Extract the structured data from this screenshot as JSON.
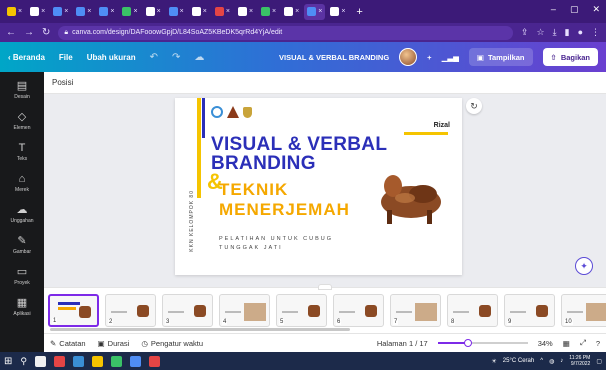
{
  "browser": {
    "tabs": [
      {
        "label": "",
        "color": "#f5c400"
      },
      {
        "label": "",
        "color": "#ffffff"
      },
      {
        "label": "",
        "color": "#4f8df5"
      },
      {
        "label": "",
        "color": "#4f8df5"
      },
      {
        "label": "",
        "color": "#4f8df5"
      },
      {
        "label": "",
        "color": "#3ac267"
      },
      {
        "label": "",
        "color": "#ffffff"
      },
      {
        "label": "",
        "color": "#4f8df5"
      },
      {
        "label": "",
        "color": "#ffffff"
      },
      {
        "label": "",
        "color": "#e54545"
      },
      {
        "label": "",
        "color": "#ffffff"
      },
      {
        "label": "",
        "color": "#3ac267"
      },
      {
        "label": "",
        "color": "#ffffff"
      },
      {
        "label": "",
        "color": "#4f8df5"
      },
      {
        "label": "",
        "color": "#ffffff"
      }
    ],
    "url": "canva.com/design/DAFooowGpjD/L84SoAZ5KBeDK5qrRd4YjA/edit",
    "window_controls": [
      "–",
      "▢",
      "✕"
    ]
  },
  "toolbar": {
    "home_label": "Beranda",
    "file_label": "File",
    "resize_label": "Ubah ukuran",
    "design_title": "VISUAL & VERBAL BRANDING",
    "present_label": "Tampilkan",
    "share_label": "Bagikan"
  },
  "rail": {
    "items": [
      {
        "label": "Desain",
        "icon": "▤"
      },
      {
        "label": "Elemen",
        "icon": "◇"
      },
      {
        "label": "Teks",
        "icon": "T"
      },
      {
        "label": "Merek",
        "icon": "⌂"
      },
      {
        "label": "Unggahan",
        "icon": "☁"
      },
      {
        "label": "Gambar",
        "icon": "✎"
      },
      {
        "label": "Proyek",
        "icon": "▭"
      },
      {
        "label": "Aplikasi",
        "icon": "▦"
      }
    ]
  },
  "subheader": {
    "label": "Posisi"
  },
  "slide": {
    "name": "Rizal",
    "title_line1": "VISUAL & VERBAL",
    "title_line2": "BRANDING",
    "ampersand": "&",
    "title2_line1": "TEKNIK",
    "title2_line2": "MENERJEMAH",
    "vertical_text": "KKN KELOMPOK 80",
    "subtitle": "PELATIHAN UNTUK CUBUG TUNGGAK JATI",
    "colors": {
      "blue": "#2b2fb8",
      "yellow": "#f5c400",
      "orange": "#f5a800"
    }
  },
  "pages": {
    "thumbnails": [
      {
        "num": "1",
        "selected": true
      },
      {
        "num": "2",
        "selected": false
      },
      {
        "num": "3",
        "selected": false
      },
      {
        "num": "4",
        "selected": false
      },
      {
        "num": "5",
        "selected": false
      },
      {
        "num": "6",
        "selected": false
      },
      {
        "num": "7",
        "selected": false
      },
      {
        "num": "8",
        "selected": false
      },
      {
        "num": "9",
        "selected": false
      },
      {
        "num": "10",
        "selected": false
      }
    ]
  },
  "footer": {
    "notes_label": "Catatan",
    "duration_label": "Durasi",
    "timer_label": "Pengatur waktu",
    "page_indicator": "Halaman 1 / 17",
    "zoom_percent": "34%",
    "zoom_fraction": 0.34
  },
  "taskbar": {
    "weather": "25°C Cerah",
    "time": "11:26 PM",
    "date": "9/7/2022"
  }
}
